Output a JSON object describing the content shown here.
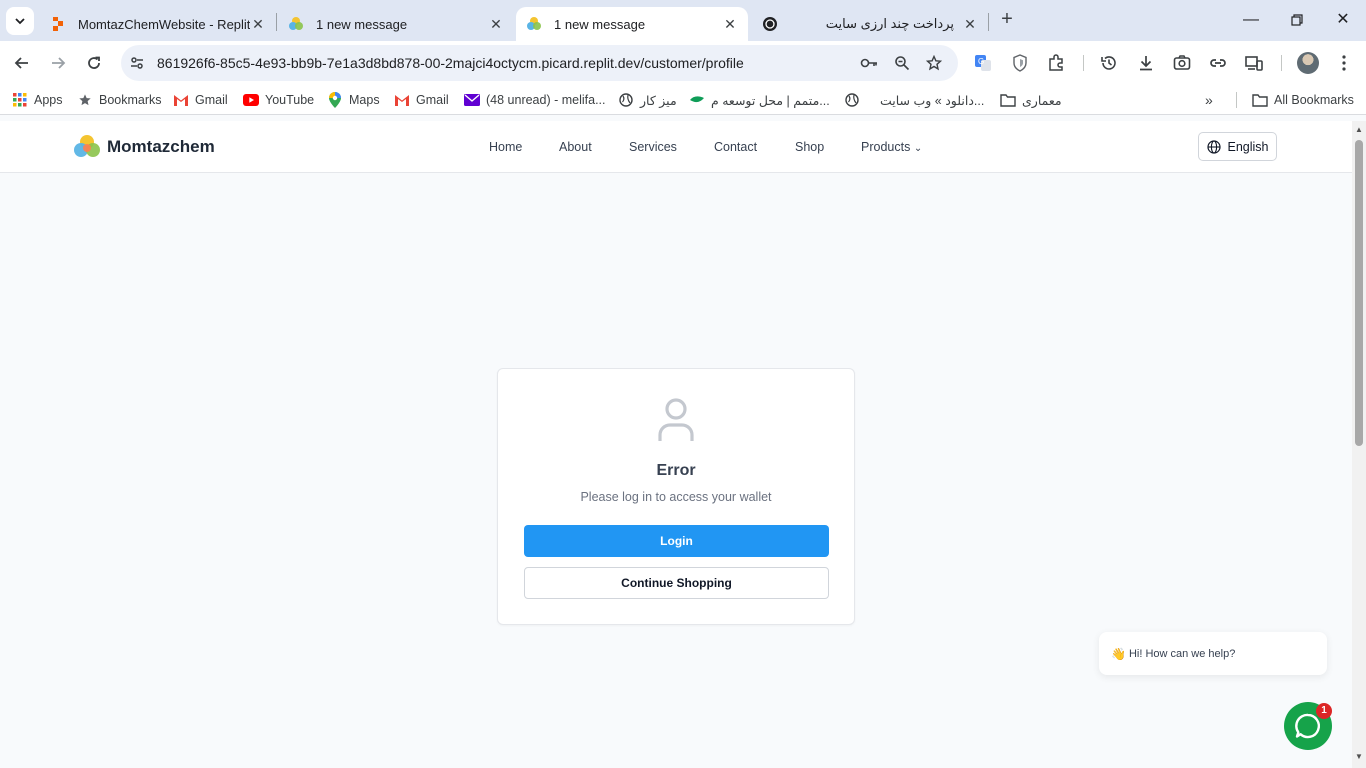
{
  "browser": {
    "tabs": [
      {
        "title": "MomtazChemWebsite - Replit",
        "icon": "replit-icon",
        "active": false
      },
      {
        "title": "1 new message",
        "icon": "momtazchem-favicon",
        "active": false
      },
      {
        "title": "1 new message",
        "icon": "momtazchem-favicon",
        "active": true
      },
      {
        "title": "پرداخت چند ارزی سایت",
        "icon": "openai-icon",
        "active": false
      }
    ],
    "url": "861926f6-85c5-4e93-bb9b-7e1a3d8bd878-00-2majci4octycm.picard.replit.dev/customer/profile",
    "bookmarks": [
      {
        "label": "Apps",
        "icon": "apps-grid-icon"
      },
      {
        "label": "Bookmarks",
        "icon": "star-icon"
      },
      {
        "label": "Gmail",
        "icon": "gmail-icon"
      },
      {
        "label": "YouTube",
        "icon": "youtube-icon"
      },
      {
        "label": "Maps",
        "icon": "maps-pin-icon"
      },
      {
        "label": "Gmail",
        "icon": "gmail-icon"
      },
      {
        "label": "(48 unread) - melifa...",
        "icon": "mail-icon"
      },
      {
        "label": "میز کار",
        "icon": "globe-icon"
      },
      {
        "label": "متمم | محل توسعه م...",
        "icon": "leaf-icon"
      },
      {
        "label": "دانلود » وب سایت...",
        "icon": "globe-icon"
      },
      {
        "label": "معماری",
        "icon": "folder-icon"
      }
    ],
    "all_bookmarks": "All Bookmarks"
  },
  "site": {
    "brand": "Momtazchem",
    "nav": [
      "Home",
      "About",
      "Services",
      "Contact",
      "Shop",
      "Products"
    ],
    "products_caret": "⌄",
    "language": "English"
  },
  "card": {
    "title": "Error",
    "message": "Please log in to access your wallet",
    "login_label": "Login",
    "continue_label": "Continue Shopping"
  },
  "chat": {
    "greeting": "Hi! How can we help?",
    "wave_icon": "👋",
    "badge_count": "1"
  },
  "colors": {
    "primary": "#2196f3",
    "chat_green": "#16a34a",
    "badge_red": "#dc2626"
  }
}
